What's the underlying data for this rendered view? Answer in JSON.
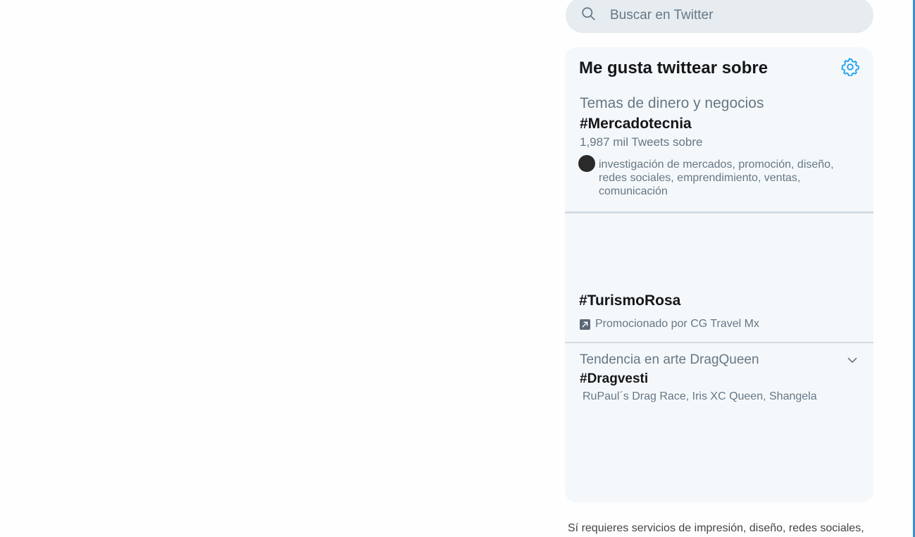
{
  "search": {
    "placeholder": "Buscar en Twitter",
    "icon": "search-icon"
  },
  "panel": {
    "title": "Me gusta twittear sobre",
    "settings_icon": "gear-icon"
  },
  "trends": [
    {
      "category": "Temas de dinero y negocios",
      "hashtag": "#Mercadotecnia",
      "count": "1,987 mil Tweets sobre",
      "description": "investigación de mercados, promoción, diseño, redes sociales, emprendimiento, ventas, comunicación"
    },
    {
      "hashtag": "#TurismoRosa",
      "promoted": "Promocionado por CG Travel Mx",
      "promoted_icon": "promoted-icon"
    },
    {
      "category": "Tendencia en arte DragQueen",
      "hashtag": "#Dragvesti",
      "related": "RuPaul´s Drag Race, Iris XC Queen, Shangela",
      "menu_icon": "chevron-down-icon"
    }
  ],
  "footer": {
    "text": "Sí requieres servicios de impresión, diseño, redes sociales,"
  },
  "colors": {
    "accent": "#1da1f2",
    "panel_bg": "#f5f8fa",
    "search_bg": "#e6ecf0",
    "muted_text": "#657786"
  }
}
